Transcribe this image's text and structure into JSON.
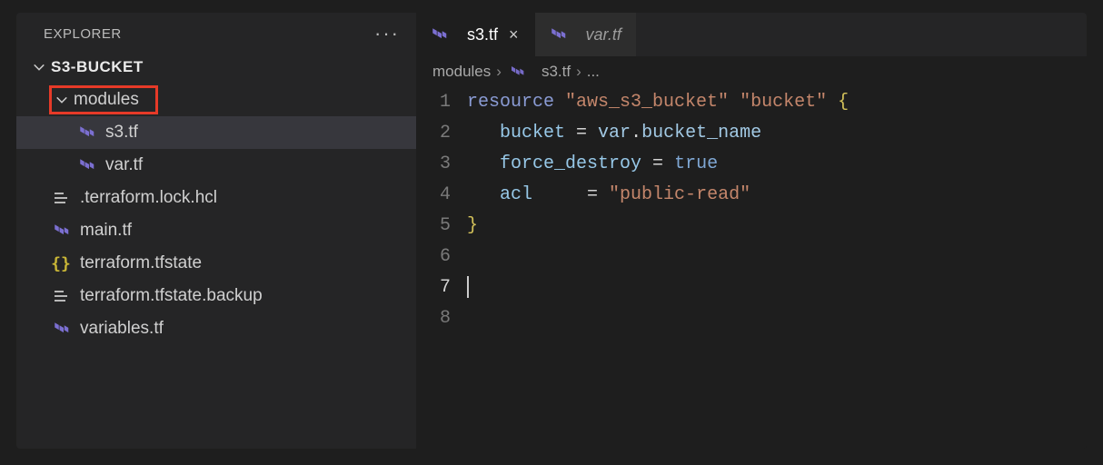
{
  "sidebar": {
    "title": "EXPLORER",
    "project": "S3-BUCKET",
    "folder": {
      "name": "modules"
    },
    "files": [
      {
        "name": "s3.tf",
        "icon": "tf",
        "indent": 1,
        "selected": true
      },
      {
        "name": "var.tf",
        "icon": "tf",
        "indent": 1,
        "selected": false
      },
      {
        "name": ".terraform.lock.hcl",
        "icon": "list",
        "indent": 0
      },
      {
        "name": "main.tf",
        "icon": "tf",
        "indent": 0
      },
      {
        "name": "terraform.tfstate",
        "icon": "json",
        "indent": 0
      },
      {
        "name": "terraform.tfstate.backup",
        "icon": "list",
        "indent": 0
      },
      {
        "name": "variables.tf",
        "icon": "tf",
        "indent": 0
      }
    ]
  },
  "tabs": [
    {
      "label": "s3.tf",
      "active": true,
      "close": true
    },
    {
      "label": "var.tf",
      "active": false,
      "close": false
    }
  ],
  "breadcrumb": {
    "parts": [
      "modules",
      "s3.tf",
      "..."
    ]
  },
  "editor": {
    "line_numbers": [
      "1",
      "2",
      "3",
      "4",
      "5",
      "6",
      "7",
      "8"
    ],
    "current_line_index": 6,
    "code": {
      "l1": {
        "kw": "resource",
        "s1": "\"aws_s3_bucket\"",
        "s2": "\"bucket\"",
        "brace": "{"
      },
      "l2": {
        "prop": "bucket",
        "eq": " = ",
        "varhead": "var",
        "dot": ".",
        "varname": "bucket_name"
      },
      "l3": {
        "prop": "force_destroy",
        "eq": " = ",
        "val": "true"
      },
      "l4": {
        "prop": "acl",
        "pad": "     = ",
        "val": "\"public-read\""
      },
      "l5": {
        "brace": "}"
      }
    }
  }
}
